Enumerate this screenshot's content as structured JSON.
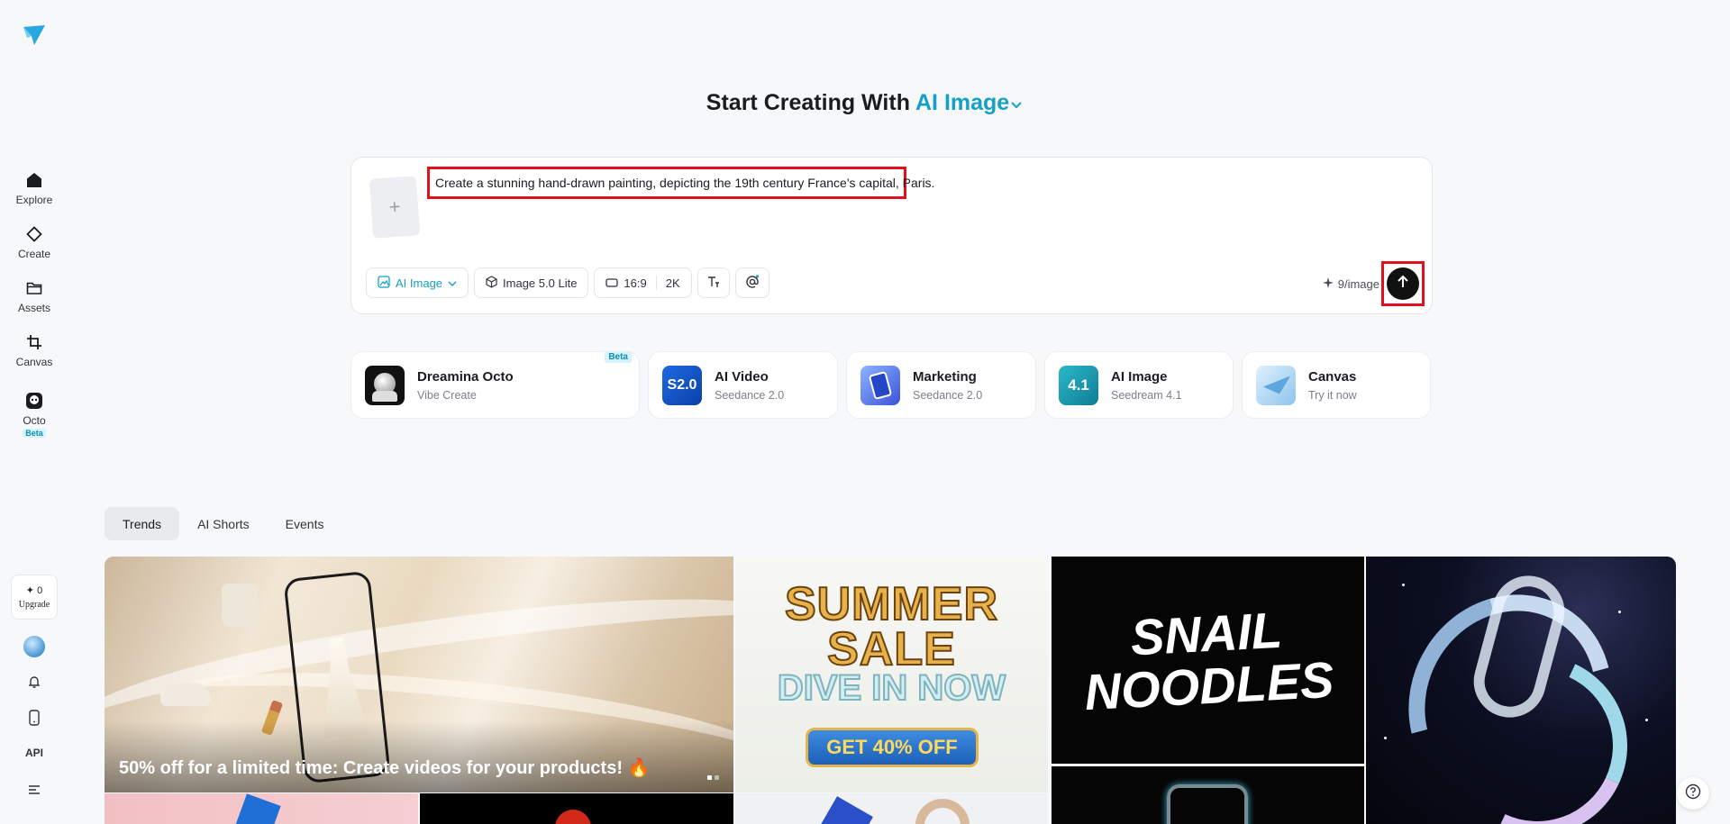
{
  "sidebar": {
    "items": [
      {
        "label": "Explore",
        "icon": "home-icon"
      },
      {
        "label": "Create",
        "icon": "diamond-icon"
      },
      {
        "label": "Assets",
        "icon": "folder-icon"
      },
      {
        "label": "Canvas",
        "icon": "crop-icon"
      },
      {
        "label": "Octo",
        "icon": "octo-icon",
        "badge": "Beta"
      }
    ],
    "credits": "0",
    "upgrade_label": "Upgrade",
    "api_label": "API"
  },
  "heading": {
    "prefix": "Start Creating With",
    "mode": "AI Image"
  },
  "prompt": {
    "text": "Create a stunning hand-drawn painting, depicting the 19th century France's capital, Paris.",
    "add_reference": "+"
  },
  "toolbar": {
    "mode": "AI Image",
    "model": "Image 5.0 Lite",
    "ratio": "16:9",
    "resolution": "2K",
    "cost": "9/image"
  },
  "features": [
    {
      "title": "Dreamina Octo",
      "subtitle": "Vibe Create",
      "badge": "Beta"
    },
    {
      "title": "AI Video",
      "subtitle": "Seedance 2.0"
    },
    {
      "title": "Marketing",
      "subtitle": "Seedance 2.0"
    },
    {
      "title": "AI Image",
      "subtitle": "Seedream 4.1"
    },
    {
      "title": "Canvas",
      "subtitle": "Try it now"
    }
  ],
  "feature_thumbs": {
    "ai_video": "S2.0",
    "ai_image": "4.1"
  },
  "tabs": [
    "Trends",
    "AI Shorts",
    "Events"
  ],
  "gallery": {
    "banner_caption": "50% off for a limited time: Create videos for your products! 🔥",
    "summer_line1": "SUMMER",
    "summer_line2": "SALE",
    "summer_line3": "DIVE IN NOW",
    "summer_offer": "GET 40% OFF",
    "snail_line1": "SNAIL",
    "snail_line2": "NOODLES"
  },
  "colors": {
    "accent": "#15a0c4",
    "highlight": "#e0101c"
  }
}
